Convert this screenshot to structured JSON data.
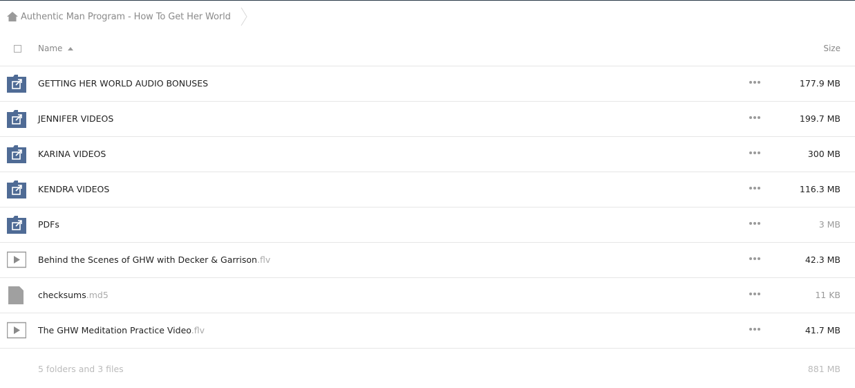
{
  "breadcrumb": {
    "home_icon": "home-icon",
    "title": "Authentic Man Program - How To Get Her World"
  },
  "header": {
    "name_label": "Name",
    "size_label": "Size",
    "sort": "ascending"
  },
  "rows": [
    {
      "type": "folder-link",
      "icon": "shared-folder-icon",
      "name": "GETTING HER WORLD AUDIO BONUSES",
      "ext": "",
      "size": "177.9 MB"
    },
    {
      "type": "folder-link",
      "icon": "shared-folder-icon",
      "name": "JENNIFER VIDEOS",
      "ext": "",
      "size": "199.7 MB"
    },
    {
      "type": "folder-link",
      "icon": "shared-folder-icon",
      "name": "KARINA VIDEOS",
      "ext": "",
      "size": "300 MB"
    },
    {
      "type": "folder-link",
      "icon": "shared-folder-icon",
      "name": "KENDRA VIDEOS",
      "ext": "",
      "size": "116.3 MB"
    },
    {
      "type": "folder-link",
      "icon": "shared-folder-icon",
      "name": "PDFs",
      "ext": "",
      "size": "3 MB"
    },
    {
      "type": "video",
      "icon": "video-file-icon",
      "name": "Behind the Scenes of GHW with Decker & Garrison",
      "ext": ".flv",
      "size": "42.3 MB"
    },
    {
      "type": "file",
      "icon": "generic-file-icon",
      "name": "checksums",
      "ext": ".md5",
      "size": "11 KB"
    },
    {
      "type": "video",
      "icon": "video-file-icon",
      "name": "The GHW Meditation Practice Video",
      "ext": ".flv",
      "size": "41.7 MB"
    }
  ],
  "footer": {
    "summary": "5 folders and 3 files",
    "total": "881 MB"
  },
  "colors": {
    "folder": "#4f6b95",
    "file_gray": "#a0a0a0",
    "divider": "#e6e6e6"
  }
}
